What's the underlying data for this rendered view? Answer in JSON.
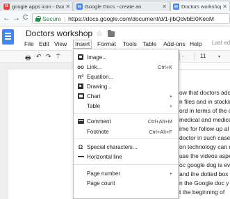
{
  "browser": {
    "tabs": [
      {
        "title": "google apps icon - Goo",
        "close": "✕",
        "icon_color": "#ea4335",
        "icon": "G"
      },
      {
        "title": "Google Docs - create an",
        "close": "✕",
        "icon_color": "#4285f4",
        "icon": "▤"
      },
      {
        "title": "Doctors workshop -",
        "close": "✕",
        "icon_color": "#4285f4",
        "icon": "▤"
      }
    ],
    "nav": {
      "back": "←",
      "forward": "→",
      "reload": "C"
    },
    "security_label": "Secure",
    "url_separator": "|",
    "url": "https://docs.google.com/document/d/1-jlbQdvbEi0KeoM"
  },
  "doc": {
    "title": "Doctors workshop",
    "star": "☆",
    "last_edit": "Last ed",
    "menus": [
      "File",
      "Edit",
      "View",
      "Insert",
      "Format",
      "Tools",
      "Table",
      "Add-ons",
      "Help"
    ]
  },
  "toolbar": {
    "print": "🖶",
    "undo": "↶",
    "redo": "↷",
    "paint_format": "⍑",
    "font_dropdown": "-",
    "font_size": "11",
    "size_dropdown": "▾"
  },
  "insert_menu": {
    "items": [
      {
        "label": "Image...",
        "icon": "image-icon",
        "shortcut": "",
        "submenu": false
      },
      {
        "label": "Link...",
        "icon": "link-icon",
        "shortcut": "Ctrl+K",
        "submenu": false
      },
      {
        "label": "Equation...",
        "icon": "equation-icon",
        "shortcut": "",
        "submenu": false
      },
      {
        "label": "Drawing...",
        "icon": "drawing-icon",
        "shortcut": "",
        "submenu": false
      },
      {
        "label": "Chart",
        "icon": "chart-icon",
        "shortcut": "",
        "submenu": true
      },
      {
        "label": "Table",
        "icon": "",
        "shortcut": "",
        "submenu": true
      },
      {
        "label": "Comment",
        "icon": "comment-icon",
        "shortcut": "Ctrl+Alt+M",
        "submenu": false
      },
      {
        "label": "Footnote",
        "icon": "footnote-icon",
        "shortcut": "Ctrl+Alt+F",
        "submenu": false
      },
      {
        "label": "Special characters...",
        "icon": "omega-icon",
        "shortcut": "",
        "submenu": false
      },
      {
        "label": "Horizontal line",
        "icon": "horizontal-line-icon",
        "shortcut": "",
        "submenu": false
      },
      {
        "label": "Page number",
        "icon": "",
        "shortcut": "",
        "submenu": true
      },
      {
        "label": "Page count",
        "icon": "",
        "shortcut": "",
        "submenu": false
      }
    ],
    "glyphs": {
      "link": "oo",
      "equation": "π²",
      "omega": "Ω",
      "submenu_arrow": "▸"
    }
  },
  "document_text": [
    "ow that doctors adc",
    "n files and in stockin",
    "ord in terms of the c",
    "medical and medica",
    "ime for follow-up al",
    "doctor in such case",
    "on technology can d",
    "use the videos aspe",
    "oc google dog is eve",
    "and the dotted box",
    "n the Google doc y",
    "t the beginning of"
  ]
}
